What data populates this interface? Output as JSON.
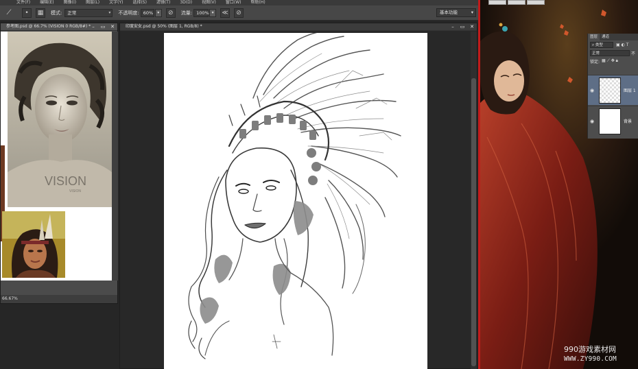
{
  "menu": {
    "items": [
      "文件(F)",
      "编辑(E)",
      "图像(I)",
      "图层(L)",
      "文字(Y)",
      "选择(S)",
      "滤镜(T)",
      "3D(D)",
      "视图(V)",
      "窗口(W)",
      "帮助(H)"
    ]
  },
  "options": {
    "mode_label": "模式:",
    "mode_value": "正常",
    "opacity_label": "不透明度:",
    "opacity_value": "60%",
    "flow_label": "流量:",
    "flow_value": "100%",
    "workspace": "基本功能"
  },
  "doc1": {
    "tab_title": "参考图.psd @ 66.7% (VISION 0 RGB/8#) *",
    "zoom": "66.67%",
    "photo_text": "VISION",
    "photo_subtext": "VISION"
  },
  "doc2": {
    "tab_title": "印度安女.psd @ 50% (图层 1, RGB/8) *"
  },
  "layers_panel": {
    "tabs": [
      "图层",
      "通道"
    ],
    "kind_label": "类型",
    "blend_mode": "正常",
    "opacity_short": "不",
    "lock_label": "锁定:",
    "layers": [
      {
        "name": "图层 1",
        "selected": true
      },
      {
        "name": "背景",
        "selected": false
      }
    ]
  },
  "watermark": {
    "line1": "990游戏素材网",
    "line2": "WWW.ZY990.COM"
  },
  "colors": {
    "accent_red": "#c21a1a",
    "selected_layer": "#5e6e86",
    "panel_bg": "#4d4d4d"
  }
}
